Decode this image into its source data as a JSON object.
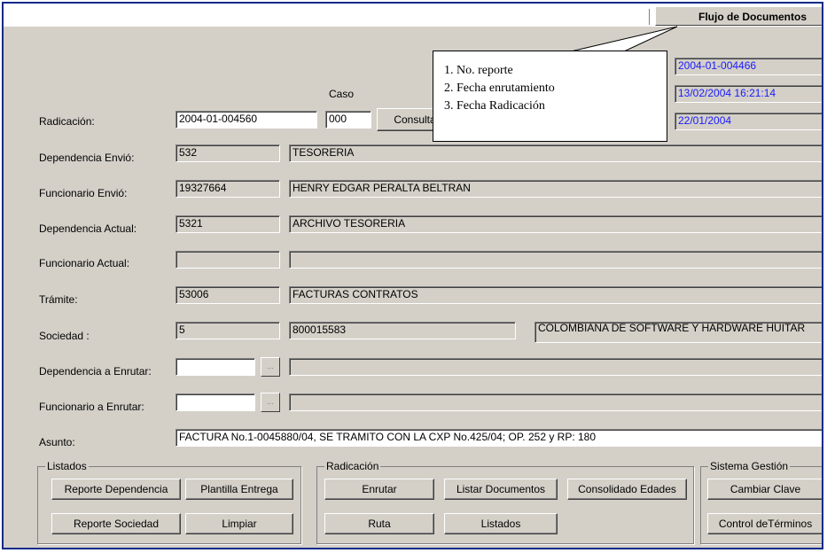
{
  "window": {
    "title": "Flujo de Documentos"
  },
  "callout": {
    "lines": [
      "1. No. reporte",
      "2. Fecha enrutamiento",
      "3. Fecha Radicación"
    ]
  },
  "form": {
    "caso_label": "Caso",
    "radicacion": {
      "label": "Radicación:",
      "value": "2004-01-004560",
      "caso": "000",
      "consultar_label": "Consultar"
    },
    "info": {
      "no_reporte": "2004-01-004466",
      "fecha_enrutamiento": "13/02/2004 16:21:14",
      "fecha_radicacion": "22/01/2004"
    },
    "dependencia_envio": {
      "label": "Dependencia Envió:",
      "code": "532",
      "name": "TESORERIA"
    },
    "funcionario_envio": {
      "label": "Funcionario Envió:",
      "code": "19327664",
      "name": "HENRY EDGAR PERALTA BELTRAN"
    },
    "dependencia_actual": {
      "label": "Dependencia Actual:",
      "code": "5321",
      "name": "ARCHIVO TESORERIA"
    },
    "funcionario_actual": {
      "label": "Funcionario Actual:",
      "code": "",
      "name": ""
    },
    "tramite": {
      "label": "Trámite:",
      "code": "53006",
      "name": "FACTURAS CONTRATOS"
    },
    "sociedad": {
      "label": "Sociedad :",
      "code": "5",
      "nit": "800015583",
      "name": "COLOMBIANA DE SOFTWARE Y HARDWARE HUITAR"
    },
    "dependencia_enrutar": {
      "label": "Dependencia a Enrutar:",
      "code": "",
      "name": ""
    },
    "funcionario_enrutar": {
      "label": "Funcionario a Enrutar:",
      "code": "",
      "name": ""
    },
    "asunto": {
      "label": "Asunto:",
      "value": "FACTURA No.1-0045880/04, SE TRAMITO CON LA CXP No.425/04;  OP. 252 y RP: 180"
    },
    "ellipsis": "..."
  },
  "groups": {
    "listados": {
      "title": "Listados",
      "buttons": [
        "Reporte Dependencia",
        "Plantilla Entrega",
        "Reporte Sociedad",
        "Limpiar"
      ]
    },
    "radicacion": {
      "title": "Radicación",
      "buttons": [
        "Enrutar",
        "Listar Documentos",
        "Consolidado Edades",
        "Ruta",
        "Listados"
      ]
    },
    "sistema": {
      "title": "Sistema Gestión",
      "buttons": [
        "Cambiar Clave",
        "Control deTérminos"
      ]
    }
  },
  "colors": {
    "border": "#0a2a8a",
    "panel": "#d4d0c8",
    "info_text": "#1a1aff"
  }
}
